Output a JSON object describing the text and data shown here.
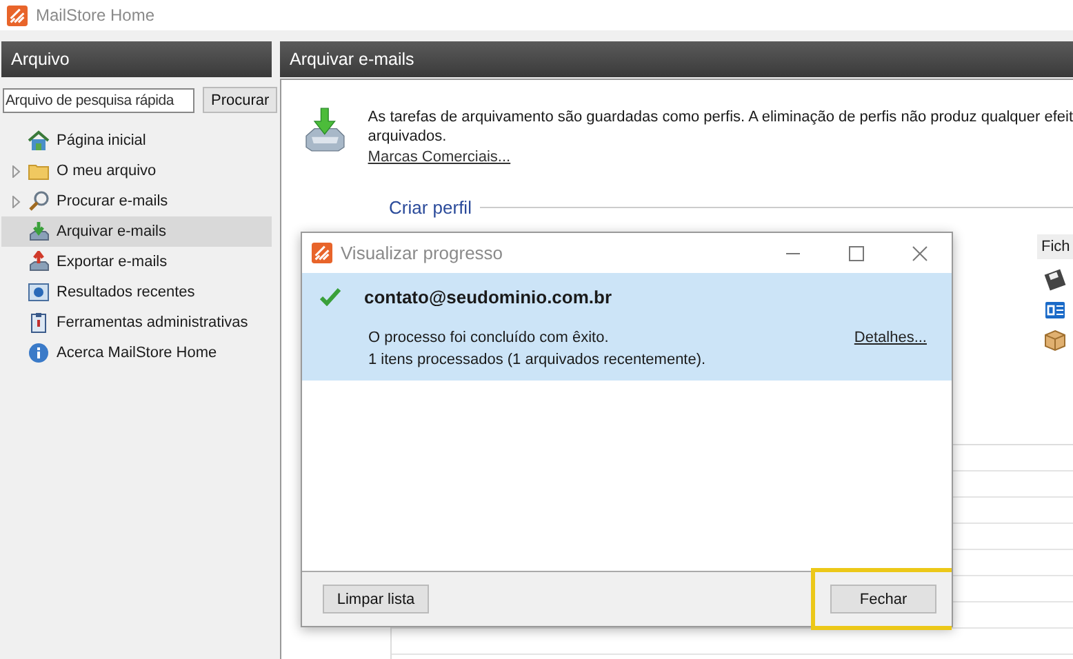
{
  "window": {
    "title": "MailStore Home"
  },
  "sidebar": {
    "title": "Arquivo",
    "search": {
      "placeholder": "Arquivo de pesquisa rápida",
      "button": "Procurar"
    },
    "items": [
      {
        "label": "Página inicial",
        "kind": "home",
        "expandable": false,
        "selected": false
      },
      {
        "label": "O meu arquivo",
        "kind": "folder",
        "expandable": true,
        "selected": false
      },
      {
        "label": "Procurar e-mails",
        "kind": "search",
        "expandable": true,
        "selected": false
      },
      {
        "label": "Arquivar e-mails",
        "kind": "archive",
        "expandable": false,
        "selected": true
      },
      {
        "label": "Exportar e-mails",
        "kind": "export",
        "expandable": false,
        "selected": false
      },
      {
        "label": "Resultados recentes",
        "kind": "results",
        "expandable": false,
        "selected": false
      },
      {
        "label": "Ferramentas administrativas",
        "kind": "tools",
        "expandable": false,
        "selected": false
      },
      {
        "label": "Acerca MailStore Home",
        "kind": "info",
        "expandable": false,
        "selected": false
      }
    ]
  },
  "main": {
    "title": "Arquivar e-mails",
    "description_lines": [
      "As tarefas de arquivamento são guardadas como perfis. A eliminação de perfis não produz qualquer efeit",
      "arquivados."
    ],
    "link": "Marcas Comerciais...",
    "section_title": "Criar perfil",
    "column_header": "Fich",
    "source_icons": [
      {
        "kind": "disk"
      },
      {
        "kind": "outlook"
      },
      {
        "kind": "box"
      }
    ]
  },
  "dialog": {
    "title": "Visualizar progresso",
    "entry": {
      "name": "contato@seudominio.com.br",
      "completed": true,
      "message": "O processo foi concluído com êxito.",
      "detail": "1 itens processados (1 arquivados recentemente).",
      "link": "Detalhes..."
    },
    "buttons": [
      {
        "label": "Limpar lista",
        "highlighted": false
      },
      {
        "label": "Fechar",
        "highlighted": true
      }
    ]
  }
}
